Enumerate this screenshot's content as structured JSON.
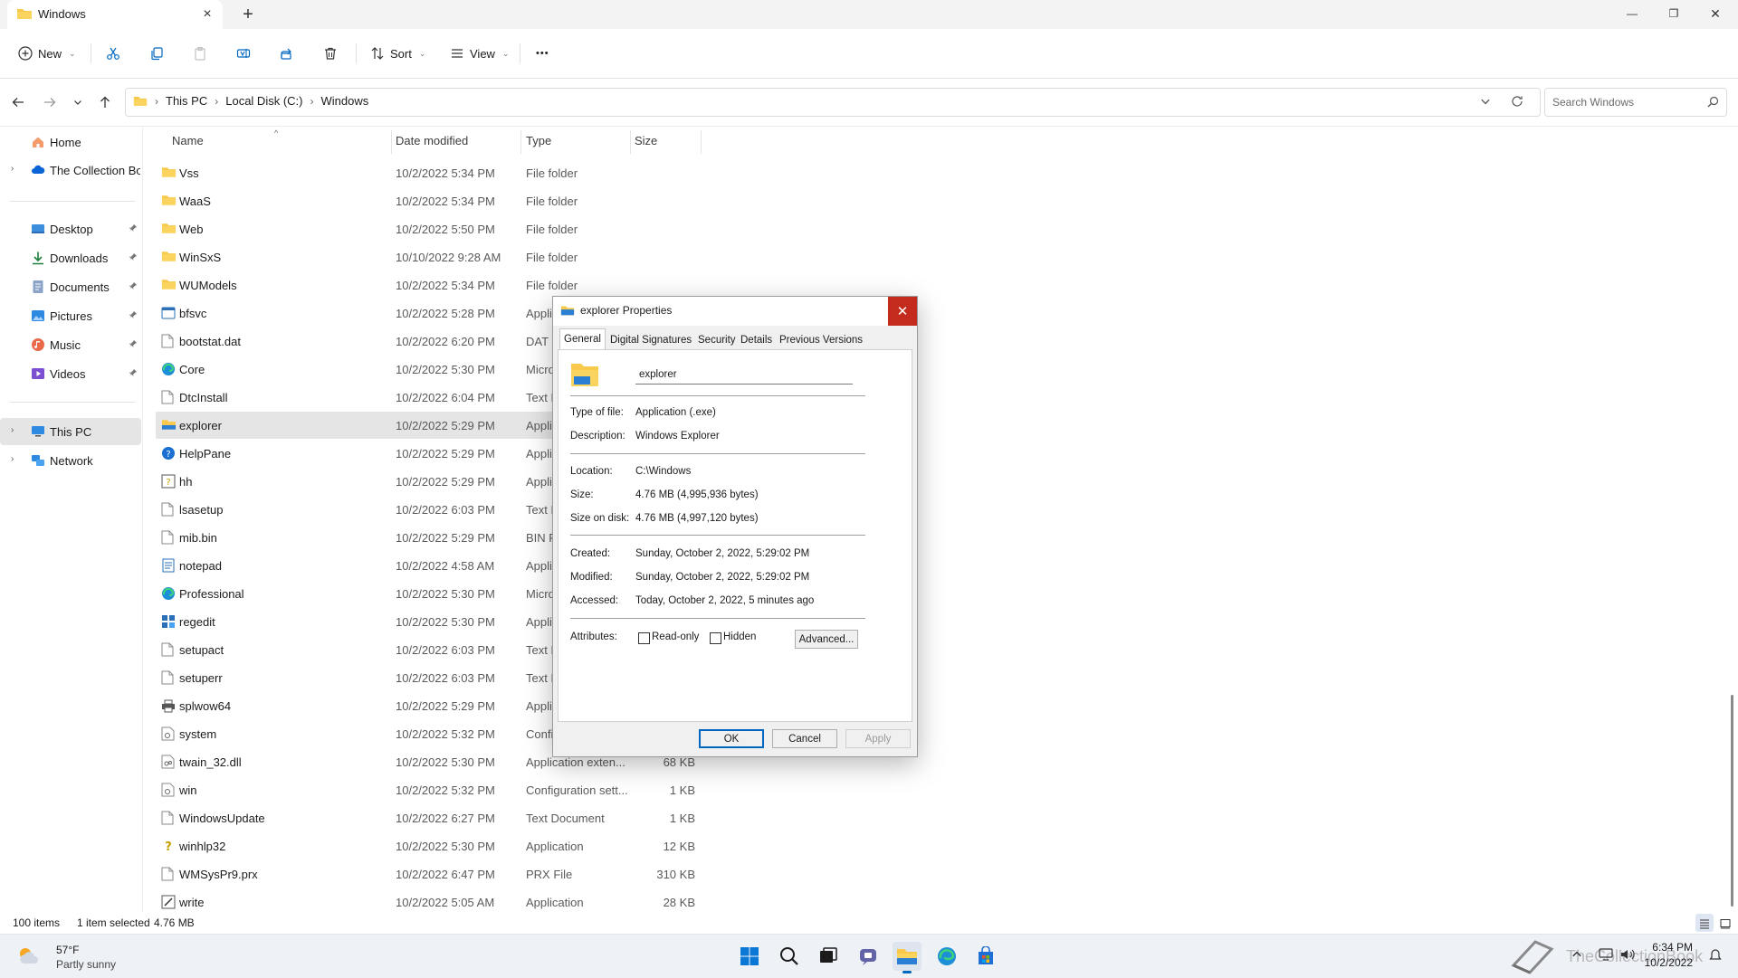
{
  "window": {
    "tab_title": "Windows",
    "tab_close": "×",
    "new_tab": "+",
    "minimize": "—",
    "maximize": "❐",
    "close": "✕"
  },
  "toolbar": {
    "new_label": "New",
    "sort_label": "Sort",
    "view_label": "View",
    "more_label": "•••"
  },
  "address": {
    "crumbs": [
      "This PC",
      "Local Disk (C:)",
      "Windows"
    ],
    "search_placeholder": "Search Windows"
  },
  "sidebar": {
    "items": [
      {
        "label": "Home",
        "icon": "home-icon",
        "expandable": false,
        "pinned": false
      },
      {
        "label": "The Collection Boo",
        "icon": "onedrive-cloud-icon",
        "expandable": true,
        "pinned": false
      },
      {
        "label": "Desktop",
        "icon": "desktop-icon",
        "expandable": false,
        "pinned": true
      },
      {
        "label": "Downloads",
        "icon": "downloads-icon",
        "expandable": false,
        "pinned": true
      },
      {
        "label": "Documents",
        "icon": "documents-icon",
        "expandable": false,
        "pinned": true
      },
      {
        "label": "Pictures",
        "icon": "pictures-icon",
        "expandable": false,
        "pinned": true
      },
      {
        "label": "Music",
        "icon": "music-icon",
        "expandable": false,
        "pinned": true
      },
      {
        "label": "Videos",
        "icon": "videos-icon",
        "expandable": false,
        "pinned": true
      },
      {
        "label": "This PC",
        "icon": "this-pc-icon",
        "expandable": true,
        "pinned": false,
        "selected": true
      },
      {
        "label": "Network",
        "icon": "network-icon",
        "expandable": true,
        "pinned": false
      }
    ]
  },
  "columns": {
    "name": "Name",
    "date": "Date modified",
    "type": "Type",
    "size": "Size"
  },
  "files": [
    {
      "name": "Vss",
      "date": "10/2/2022 5:34 PM",
      "type": "File folder",
      "size": "",
      "icon": "folder"
    },
    {
      "name": "WaaS",
      "date": "10/2/2022 5:34 PM",
      "type": "File folder",
      "size": "",
      "icon": "folder"
    },
    {
      "name": "Web",
      "date": "10/2/2022 5:50 PM",
      "type": "File folder",
      "size": "",
      "icon": "folder"
    },
    {
      "name": "WinSxS",
      "date": "10/10/2022 9:28 AM",
      "type": "File folder",
      "size": "",
      "icon": "folder"
    },
    {
      "name": "WUModels",
      "date": "10/2/2022 5:34 PM",
      "type": "File folder",
      "size": "",
      "icon": "folder"
    },
    {
      "name": "bfsvc",
      "date": "10/2/2022 5:28 PM",
      "type": "Appli",
      "size": "",
      "icon": "app"
    },
    {
      "name": "bootstat.dat",
      "date": "10/2/2022 6:20 PM",
      "type": "DAT F",
      "size": "",
      "icon": "doc"
    },
    {
      "name": "Core",
      "date": "10/2/2022 5:30 PM",
      "type": "Micro",
      "size": "",
      "icon": "edge"
    },
    {
      "name": "DtcInstall",
      "date": "10/2/2022 6:04 PM",
      "type": "Text D",
      "size": "",
      "icon": "doc"
    },
    {
      "name": "explorer",
      "date": "10/2/2022 5:29 PM",
      "type": "Appli",
      "size": "",
      "icon": "explorer",
      "selected": true
    },
    {
      "name": "HelpPane",
      "date": "10/2/2022 5:29 PM",
      "type": "Appli",
      "size": "",
      "icon": "help"
    },
    {
      "name": "hh",
      "date": "10/2/2022 5:29 PM",
      "type": "Appli",
      "size": "",
      "icon": "hh"
    },
    {
      "name": "lsasetup",
      "date": "10/2/2022 6:03 PM",
      "type": "Text D",
      "size": "",
      "icon": "doc"
    },
    {
      "name": "mib.bin",
      "date": "10/2/2022 5:29 PM",
      "type": "BIN F",
      "size": "",
      "icon": "doc"
    },
    {
      "name": "notepad",
      "date": "10/2/2022 4:58 AM",
      "type": "Appli",
      "size": "",
      "icon": "notepad"
    },
    {
      "name": "Professional",
      "date": "10/2/2022 5:30 PM",
      "type": "Micro",
      "size": "",
      "icon": "edge"
    },
    {
      "name": "regedit",
      "date": "10/2/2022 5:30 PM",
      "type": "Appli",
      "size": "",
      "icon": "regedit"
    },
    {
      "name": "setupact",
      "date": "10/2/2022 6:03 PM",
      "type": "Text D",
      "size": "",
      "icon": "doc"
    },
    {
      "name": "setuperr",
      "date": "10/2/2022 6:03 PM",
      "type": "Text D",
      "size": "",
      "icon": "doc"
    },
    {
      "name": "splwow64",
      "date": "10/2/2022 5:29 PM",
      "type": "Appli",
      "size": "",
      "icon": "printer"
    },
    {
      "name": "system",
      "date": "10/2/2022 5:32 PM",
      "type": "Confi",
      "size": "",
      "icon": "config"
    },
    {
      "name": "twain_32.dll",
      "date": "10/2/2022 5:30 PM",
      "type": "Application exten...",
      "size": "68 KB",
      "icon": "dll"
    },
    {
      "name": "win",
      "date": "10/2/2022 5:32 PM",
      "type": "Configuration sett...",
      "size": "1 KB",
      "icon": "config"
    },
    {
      "name": "WindowsUpdate",
      "date": "10/2/2022 6:27 PM",
      "type": "Text Document",
      "size": "1 KB",
      "icon": "doc"
    },
    {
      "name": "winhlp32",
      "date": "10/2/2022 5:30 PM",
      "type": "Application",
      "size": "12 KB",
      "icon": "winhlp"
    },
    {
      "name": "WMSysPr9.prx",
      "date": "10/2/2022 6:47 PM",
      "type": "PRX File",
      "size": "310 KB",
      "icon": "doc"
    },
    {
      "name": "write",
      "date": "10/2/2022 5:05 AM",
      "type": "Application",
      "size": "28 KB",
      "icon": "write"
    }
  ],
  "status": {
    "count": "100 items",
    "selected": "1 item selected",
    "size": "4.76 MB"
  },
  "dialog": {
    "title": "explorer Properties",
    "tabs": [
      "General",
      "Digital Signatures",
      "Security",
      "Details",
      "Previous Versions"
    ],
    "name_value": "explorer",
    "type_label": "Type of file:",
    "type_value": "Application (.exe)",
    "desc_label": "Description:",
    "desc_value": "Windows Explorer",
    "location_label": "Location:",
    "location_value": "C:\\Windows",
    "size_label": "Size:",
    "size_value": "4.76 MB (4,995,936 bytes)",
    "size_disk_label": "Size on disk:",
    "size_disk_value": "4.76 MB (4,997,120 bytes)",
    "created_label": "Created:",
    "created_value": "Sunday, October 2, 2022, 5:29:02 PM",
    "modified_label": "Modified:",
    "modified_value": "Sunday, October 2, 2022, 5:29:02 PM",
    "accessed_label": "Accessed:",
    "accessed_value": "Today, October 2, 2022, 5 minutes ago",
    "attributes_label": "Attributes:",
    "readonly_label": "Read-only",
    "hidden_label": "Hidden",
    "advanced_label": "Advanced...",
    "ok_label": "OK",
    "cancel_label": "Cancel",
    "apply_label": "Apply"
  },
  "taskbar": {
    "weather_temp": "57°F",
    "weather_desc": "Partly sunny",
    "time": "6:34 PM",
    "date": "10/2/2022",
    "watermark": "TheCollectionBook"
  },
  "colors": {
    "accent": "#0067c0",
    "folder": "#f8c94a",
    "close_red": "#c42b1c"
  }
}
